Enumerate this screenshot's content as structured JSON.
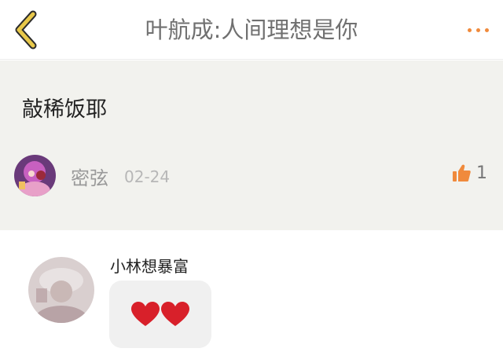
{
  "header": {
    "title": "叶航成:人间理想是你",
    "back_icon": "chevron-left-icon",
    "more_icon": "more-dots-icon"
  },
  "post": {
    "text": "敲稀饭耶",
    "author": "密弦",
    "date": "02-24",
    "like_count": "1",
    "like_icon": "thumbs-up-icon"
  },
  "reply": {
    "name": "小林想暴富",
    "content_icons": [
      "red-heart-icon",
      "red-heart-icon"
    ]
  },
  "colors": {
    "accent": "#f08a3c",
    "back_chevron": "#e8c84a",
    "post_bg": "#f2f2ee",
    "heart": "#d8202a"
  }
}
